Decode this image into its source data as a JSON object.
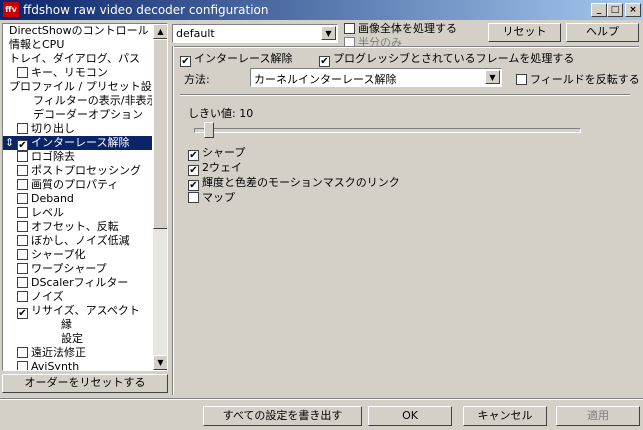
{
  "window": {
    "title": "ffdshow raw video decoder configuration",
    "icon_text": "ffv"
  },
  "tree": {
    "items": [
      {
        "label": "DirectShowのコントロール",
        "indent": 0,
        "checkbox": false
      },
      {
        "label": "情報とCPU",
        "indent": 0,
        "checkbox": false
      },
      {
        "label": "トレイ、ダイアログ、パス",
        "indent": 0,
        "checkbox": false
      },
      {
        "label": "キー、リモコン",
        "indent": 1,
        "checkbox": true,
        "checked": false
      },
      {
        "label": "プロファイル / プリセット設定",
        "indent": 0,
        "checkbox": false
      },
      {
        "label": "フィルターの表示/非表示",
        "indent": 2,
        "checkbox": false
      },
      {
        "label": "デコーダーオプション",
        "indent": 2,
        "checkbox": false
      },
      {
        "label": "切り出し",
        "indent": 1,
        "checkbox": true,
        "checked": false
      },
      {
        "label": "インターレース解除",
        "indent": 1,
        "checkbox": true,
        "checked": true,
        "selected": true
      },
      {
        "label": "ロゴ除去",
        "indent": 1,
        "checkbox": true,
        "checked": false
      },
      {
        "label": "ポストプロセッシング",
        "indent": 1,
        "checkbox": true,
        "checked": false
      },
      {
        "label": "画質のプロパティ",
        "indent": 1,
        "checkbox": true,
        "checked": false
      },
      {
        "label": "Deband",
        "indent": 1,
        "checkbox": true,
        "checked": false
      },
      {
        "label": "レベル",
        "indent": 1,
        "checkbox": true,
        "checked": false
      },
      {
        "label": "オフセット、反転",
        "indent": 1,
        "checkbox": true,
        "checked": false
      },
      {
        "label": "ぼかし、ノイズ低減",
        "indent": 1,
        "checkbox": true,
        "checked": false
      },
      {
        "label": "シャープ化",
        "indent": 1,
        "checkbox": true,
        "checked": false
      },
      {
        "label": "ワープシャープ",
        "indent": 1,
        "checkbox": true,
        "checked": false
      },
      {
        "label": "DScalerフィルター",
        "indent": 1,
        "checkbox": true,
        "checked": false
      },
      {
        "label": "ノイズ",
        "indent": 1,
        "checkbox": true,
        "checked": false
      },
      {
        "label": "リサイズ、アスペクト",
        "indent": 1,
        "checkbox": true,
        "checked": true
      },
      {
        "label": "縁",
        "indent": 3,
        "checkbox": false
      },
      {
        "label": "設定",
        "indent": 3,
        "checkbox": false
      },
      {
        "label": "遠近法修正",
        "indent": 1,
        "checkbox": true,
        "checked": false
      },
      {
        "label": "AviSynth",
        "indent": 1,
        "checkbox": true,
        "checked": false
      }
    ],
    "move_arrows": "⇕",
    "reset_order_label": "オーダーをリセットする"
  },
  "top": {
    "preset_value": "default",
    "process_whole_label": "画像全体を処理する",
    "half_only_label": "半分のみ",
    "reset_label": "リセット",
    "help_label": "ヘルプ"
  },
  "deint": {
    "enable_label": "インターレース解除",
    "enable_checked": true,
    "progressive_label": "プログレッシブとされているフレームを処理する",
    "progressive_checked": true,
    "method_label": "方法:",
    "method_value": "カーネルインターレース解除",
    "invert_field_label": "フィールドを反転する",
    "invert_field_checked": false,
    "threshold_label": "しきい値: 10",
    "threshold_value": 10,
    "options": [
      {
        "label": "シャープ",
        "checked": true
      },
      {
        "label": "2ウェイ",
        "checked": true
      },
      {
        "label": "輝度と色差のモーションマスクのリンク",
        "checked": true
      },
      {
        "label": "マップ",
        "checked": false
      }
    ]
  },
  "bottom": {
    "export_label": "すべての設定を書き出す",
    "ok_label": "OK",
    "cancel_label": "キャンセル",
    "apply_label": "適用"
  },
  "colors": {
    "selection": "#0a246a",
    "face": "#d4d0c8",
    "title_start": "#0a246a",
    "title_end": "#a6caf0"
  }
}
